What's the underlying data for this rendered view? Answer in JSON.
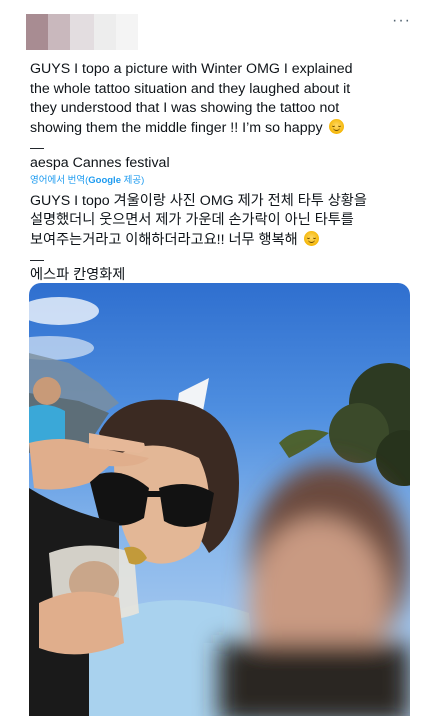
{
  "header": {
    "more_icon": "more-horizontal-icon",
    "more_label": "···"
  },
  "tweet": {
    "text_en_lines": [
      "GUYS I topo a picture with Winter OMG I explained",
      "the whole tattoo situation and they laughed about it",
      "they understood that I was showing the tattoo not",
      "showing them the middle finger !! I’m so happy"
    ],
    "dash": "—",
    "event_line": "aespa Cannes festival",
    "translation_note_prefix": "영어에서 번역(",
    "translation_note_brand": "Google",
    "translation_note_suffix": " 제공)",
    "text_ko_lines": [
      "GUYS I topo 겨울이랑 사진 OMG 제가 전체 타투 상황을",
      "설명했더니 웃으면서 제가 가운데 손가락이 아닌 타투를",
      "보여주는거라고 이해하더라고요!! 너무 행복해"
    ],
    "event_line_ko": "에스파 칸영화제",
    "emoji_icon": "smiling-face-icon"
  },
  "media": {
    "photo_icon": "selfie-photo",
    "sky_color": "#2f6fcf"
  }
}
